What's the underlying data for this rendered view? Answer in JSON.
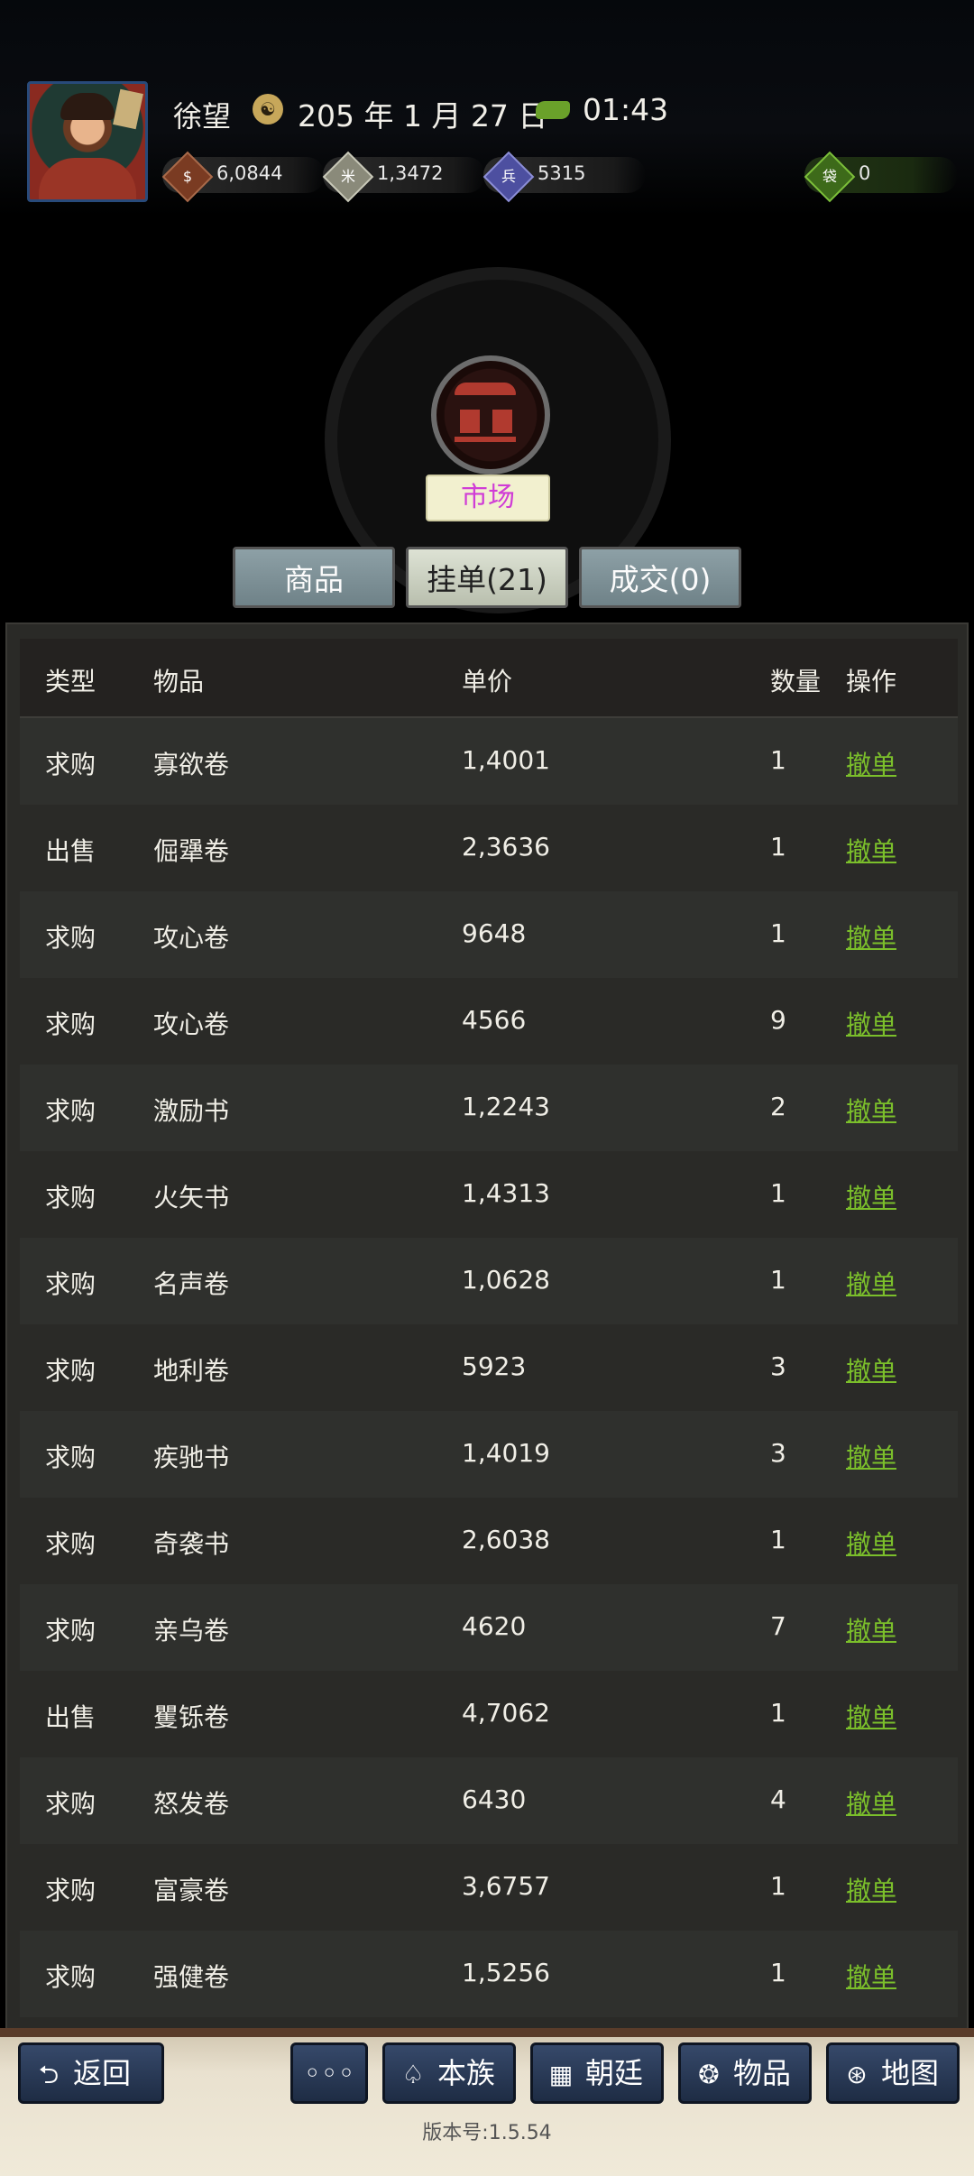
{
  "header": {
    "name": "徐望",
    "date": "205 年 1 月 27 日",
    "time": "01:43",
    "resources": [
      {
        "icon": "coin-icon",
        "value": "6,0844",
        "color": "#7a3b22"
      },
      {
        "icon": "grain-icon",
        "value": "1,3472",
        "color": "#9a9a8a"
      },
      {
        "icon": "soldier-icon",
        "value": "5315",
        "color": "#4d4fa0"
      },
      {
        "icon": "bag-icon",
        "value": "0",
        "color": "#3d6a1a"
      }
    ]
  },
  "market": {
    "title": "市场"
  },
  "tabs": [
    {
      "label": "商品",
      "active": false
    },
    {
      "label": "挂单(21)",
      "active": true
    },
    {
      "label": "成交(0)",
      "active": false
    }
  ],
  "table": {
    "headers": [
      "类型",
      "物品",
      "单价",
      "数量",
      "操作"
    ],
    "rows": [
      {
        "type": "求购",
        "item": "寡欲卷",
        "price": "1,4001",
        "qty": "1",
        "op": "撤单"
      },
      {
        "type": "出售",
        "item": "倔犟卷",
        "price": "2,3636",
        "qty": "1",
        "op": "撤单"
      },
      {
        "type": "求购",
        "item": "攻心卷",
        "price": "9648",
        "qty": "1",
        "op": "撤单"
      },
      {
        "type": "求购",
        "item": "攻心卷",
        "price": "4566",
        "qty": "9",
        "op": "撤单"
      },
      {
        "type": "求购",
        "item": "激励书",
        "price": "1,2243",
        "qty": "2",
        "op": "撤单"
      },
      {
        "type": "求购",
        "item": "火矢书",
        "price": "1,4313",
        "qty": "1",
        "op": "撤单"
      },
      {
        "type": "求购",
        "item": "名声卷",
        "price": "1,0628",
        "qty": "1",
        "op": "撤单"
      },
      {
        "type": "求购",
        "item": "地利卷",
        "price": "5923",
        "qty": "3",
        "op": "撤单"
      },
      {
        "type": "求购",
        "item": "疾驰书",
        "price": "1,4019",
        "qty": "3",
        "op": "撤单"
      },
      {
        "type": "求购",
        "item": "奇袭书",
        "price": "2,6038",
        "qty": "1",
        "op": "撤单"
      },
      {
        "type": "求购",
        "item": "亲乌卷",
        "price": "4620",
        "qty": "7",
        "op": "撤单"
      },
      {
        "type": "出售",
        "item": "矍铄卷",
        "price": "4,7062",
        "qty": "1",
        "op": "撤单"
      },
      {
        "type": "求购",
        "item": "怒发卷",
        "price": "6430",
        "qty": "4",
        "op": "撤单"
      },
      {
        "type": "求购",
        "item": "富豪卷",
        "price": "3,6757",
        "qty": "1",
        "op": "撤单"
      },
      {
        "type": "求购",
        "item": "强健卷",
        "price": "1,5256",
        "qty": "1",
        "op": "撤单"
      }
    ]
  },
  "nav": {
    "back": "返回",
    "more": "◦◦◦",
    "clan": "本族",
    "court": "朝廷",
    "items": "物品",
    "map": "地图"
  },
  "version": "版本号:1.5.54"
}
